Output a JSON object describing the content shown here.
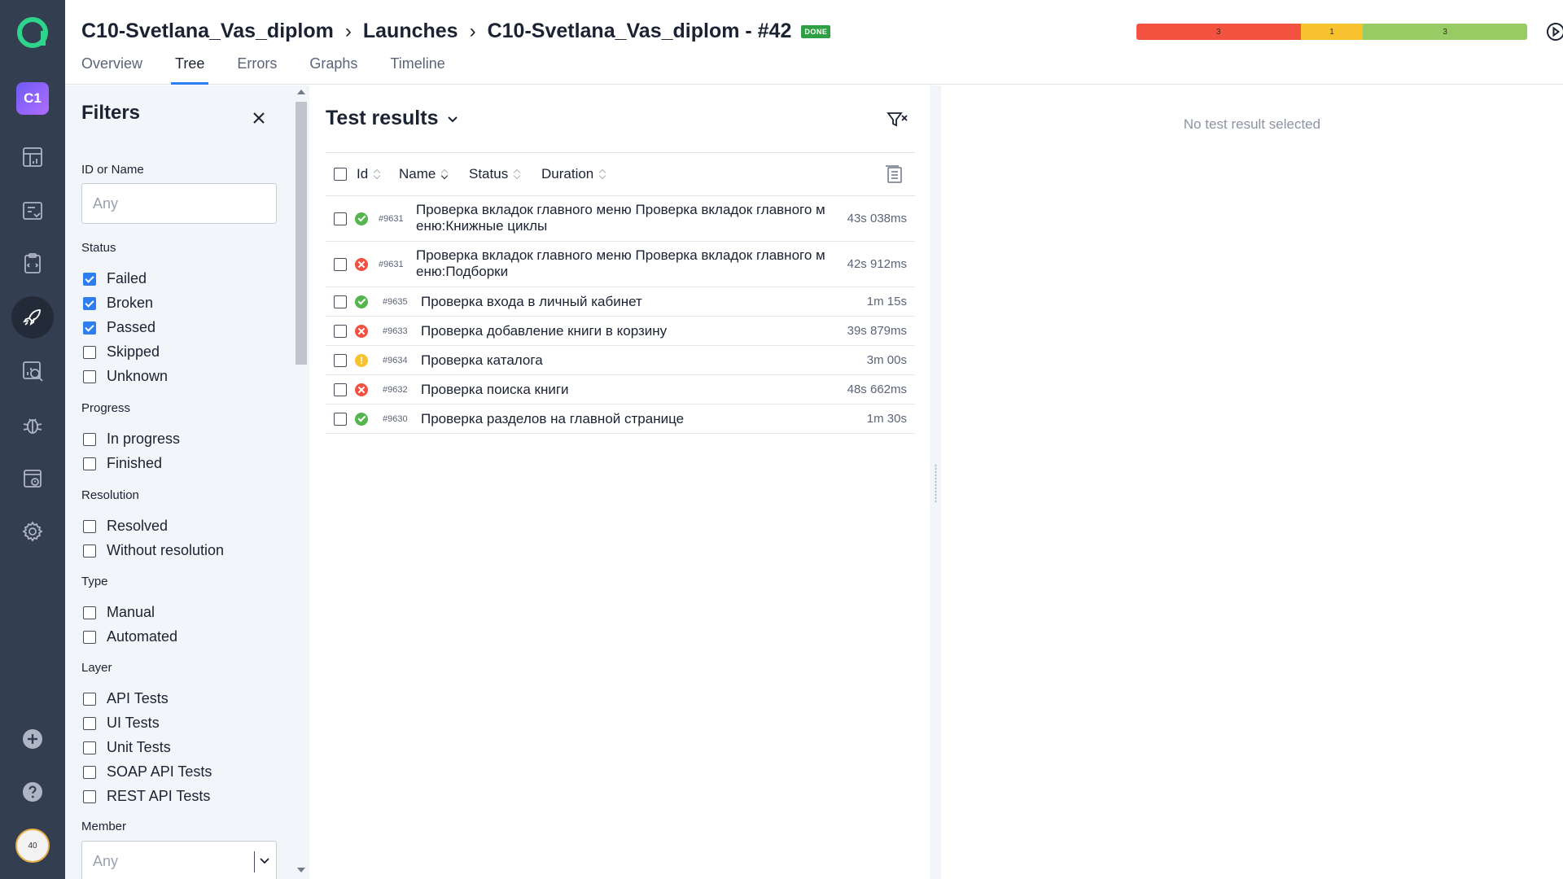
{
  "project": {
    "badge": "C1"
  },
  "user": {
    "avatar_text": "40"
  },
  "header": {
    "breadcrumb": [
      "C10-Svetlana_Vas_diplom",
      "Launches",
      "C10-Svetlana_Vas_diplom - #42"
    ],
    "badge": "DONE",
    "tabs": [
      "Overview",
      "Tree",
      "Errors",
      "Graphs",
      "Timeline"
    ],
    "active_tab": "Tree",
    "statusbar": [
      {
        "label": "3",
        "color": "#f2523f",
        "share": 0.42
      },
      {
        "label": "1",
        "color": "#f7c22d",
        "share": 0.16
      },
      {
        "label": "3",
        "color": "#97cc64",
        "share": 0.42
      }
    ]
  },
  "filters": {
    "title": "Filters",
    "id_label": "ID or Name",
    "id_placeholder": "Any",
    "status_label": "Status",
    "status": [
      {
        "label": "Failed",
        "checked": true
      },
      {
        "label": "Broken",
        "checked": true
      },
      {
        "label": "Passed",
        "checked": true
      },
      {
        "label": "Skipped",
        "checked": false
      },
      {
        "label": "Unknown",
        "checked": false
      }
    ],
    "progress_label": "Progress",
    "progress": [
      "In progress",
      "Finished"
    ],
    "resolution_label": "Resolution",
    "resolution": [
      "Resolved",
      "Without resolution"
    ],
    "type_label": "Type",
    "type": [
      "Manual",
      "Automated"
    ],
    "layer_label": "Layer",
    "layer": [
      "API Tests",
      "UI Tests",
      "Unit Tests",
      "SOAP API Tests",
      "REST API Tests"
    ],
    "member_label": "Member",
    "member_placeholder": "Any"
  },
  "results": {
    "title": "Test results",
    "columns": [
      "Id",
      "Name",
      "Status",
      "Duration"
    ],
    "rows": [
      {
        "id": "#9631",
        "name_line1": "Проверка вкладок главного меню Проверка вкладок главного м",
        "name_line2": "еню:Книжные циклы",
        "status": "passed",
        "duration": "43s 038ms"
      },
      {
        "id": "#9631",
        "name_line1": "Проверка вкладок главного меню Проверка вкладок главного м",
        "name_line2": "еню:Подборки",
        "status": "failed",
        "duration": "42s 912ms"
      },
      {
        "id": "#9635",
        "name_line1": "Проверка входа в личный кабинет",
        "status": "passed",
        "duration": "1m 15s"
      },
      {
        "id": "#9633",
        "name_line1": "Проверка добавление книги в корзину",
        "status": "failed",
        "duration": "39s 879ms"
      },
      {
        "id": "#9634",
        "name_line1": "Проверка каталога",
        "status": "broken",
        "duration": "3m 00s"
      },
      {
        "id": "#9632",
        "name_line1": "Проверка поиска книги",
        "status": "failed",
        "duration": "48s 662ms"
      },
      {
        "id": "#9630",
        "name_line1": "Проверка разделов на главной странице",
        "status": "passed",
        "duration": "1m 30s"
      }
    ]
  },
  "detail": {
    "empty_text": "No test result selected"
  }
}
